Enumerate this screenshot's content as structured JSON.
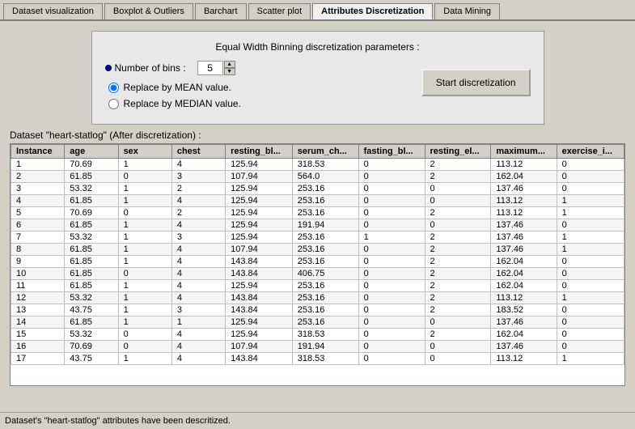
{
  "tabs": [
    {
      "label": "Dataset visualization",
      "active": false
    },
    {
      "label": "Boxplot & Outliers",
      "active": false
    },
    {
      "label": "Barchart",
      "active": false
    },
    {
      "label": "Scatter plot",
      "active": false
    },
    {
      "label": "Attributes Discretization",
      "active": true
    },
    {
      "label": "Data Mining",
      "active": false
    }
  ],
  "params": {
    "title": "Equal Width Binning discretization parameters :",
    "bins_label": "Number of bins :",
    "bins_value": "5",
    "radio1_label": "Replace by MEAN value.",
    "radio2_label": "Replace by MEDIAN value.",
    "start_button_label": "Start discretization"
  },
  "dataset_title": "Dataset \"heart-statlog\" (After discretization) :",
  "table": {
    "headers": [
      "Instance",
      "age",
      "sex",
      "chest",
      "resting_bl...",
      "serum_ch...",
      "fasting_bl...",
      "resting_el...",
      "maximum...",
      "exercise_i..."
    ],
    "rows": [
      [
        "1",
        "70.69",
        "1",
        "4",
        "125.94",
        "318.53",
        "0",
        "2",
        "113.12",
        "0"
      ],
      [
        "2",
        "61.85",
        "0",
        "3",
        "107.94",
        "564.0",
        "0",
        "2",
        "162.04",
        "0"
      ],
      [
        "3",
        "53.32",
        "1",
        "2",
        "125.94",
        "253.16",
        "0",
        "0",
        "137.46",
        "0"
      ],
      [
        "4",
        "61.85",
        "1",
        "4",
        "125.94",
        "253.16",
        "0",
        "0",
        "113.12",
        "1"
      ],
      [
        "5",
        "70.69",
        "0",
        "2",
        "125.94",
        "253.16",
        "0",
        "2",
        "113.12",
        "1"
      ],
      [
        "6",
        "61.85",
        "1",
        "4",
        "125.94",
        "191.94",
        "0",
        "0",
        "137.46",
        "0"
      ],
      [
        "7",
        "53.32",
        "1",
        "3",
        "125.94",
        "253.16",
        "1",
        "2",
        "137.46",
        "1"
      ],
      [
        "8",
        "61.85",
        "1",
        "4",
        "107.94",
        "253.16",
        "0",
        "2",
        "137.46",
        "1"
      ],
      [
        "9",
        "61.85",
        "1",
        "4",
        "143.84",
        "253.16",
        "0",
        "2",
        "162.04",
        "0"
      ],
      [
        "10",
        "61.85",
        "0",
        "4",
        "143.84",
        "406.75",
        "0",
        "2",
        "162.04",
        "0"
      ],
      [
        "11",
        "61.85",
        "1",
        "4",
        "125.94",
        "253.16",
        "0",
        "2",
        "162.04",
        "0"
      ],
      [
        "12",
        "53.32",
        "1",
        "4",
        "143.84",
        "253.16",
        "0",
        "2",
        "113.12",
        "1"
      ],
      [
        "13",
        "43.75",
        "1",
        "3",
        "143.84",
        "253.16",
        "0",
        "2",
        "183.52",
        "0"
      ],
      [
        "14",
        "61.85",
        "1",
        "1",
        "125.94",
        "253.16",
        "0",
        "0",
        "137.46",
        "0"
      ],
      [
        "15",
        "53.32",
        "0",
        "4",
        "125.94",
        "318.53",
        "0",
        "2",
        "162.04",
        "0"
      ],
      [
        "16",
        "70.69",
        "0",
        "4",
        "107.94",
        "191.94",
        "0",
        "0",
        "137.46",
        "0"
      ],
      [
        "17",
        "43.75",
        "1",
        "4",
        "143.84",
        "318.53",
        "0",
        "0",
        "113.12",
        "1"
      ]
    ]
  },
  "status_text": "Dataset's \"heart-statlog\" attributes have been descritized."
}
